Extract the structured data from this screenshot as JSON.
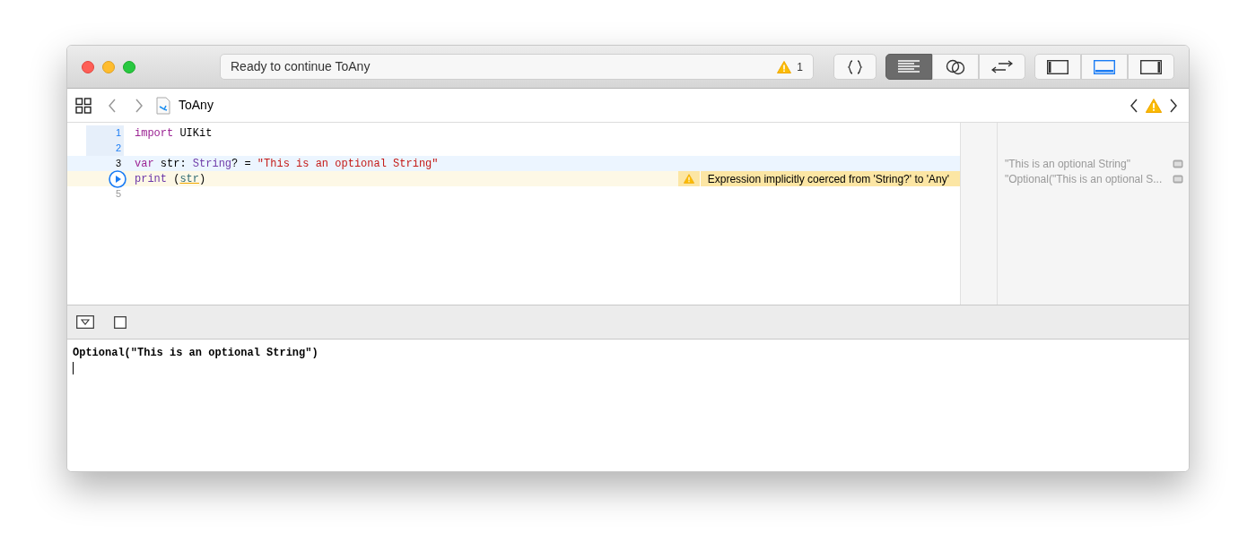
{
  "window": {
    "activity": {
      "status": "Ready to continue ToAny",
      "warning_count": "1"
    }
  },
  "editor_modes": [
    {
      "kind": "code",
      "selected": false
    },
    {
      "kind": "lines",
      "selected": true
    },
    {
      "kind": "rings",
      "selected": false
    },
    {
      "kind": "arrows",
      "selected": false
    }
  ],
  "panel_toggles": [
    {
      "kind": "left",
      "on": false
    },
    {
      "kind": "bottom",
      "on": true
    },
    {
      "kind": "right",
      "on": false
    }
  ],
  "jump_bar": {
    "file": "ToAny"
  },
  "code_lines": [
    {
      "number": "1",
      "executed": true,
      "current": false,
      "tokens": [
        {
          "kind": "keyword",
          "text": "import"
        },
        {
          "kind": "plain",
          "text": " UIKit"
        }
      ]
    },
    {
      "number": "2",
      "executed": true,
      "current": false
    },
    {
      "number": "3",
      "executed": false,
      "current": true,
      "tokens": [
        {
          "kind": "keyword",
          "text": "var"
        },
        {
          "kind": "plain",
          "text": " str: "
        },
        {
          "kind": "type",
          "text": "String"
        },
        {
          "kind": "plain",
          "text": "? = "
        },
        {
          "kind": "string",
          "text": "\"This is an optional String\""
        }
      ],
      "result": "\"This is an optional String\""
    },
    {
      "run_marker": true,
      "executed": false,
      "current": false,
      "tokens": [
        {
          "kind": "function",
          "text": "print"
        },
        {
          "kind": "plain",
          "text": " ("
        },
        {
          "kind": "variable",
          "text": "str"
        },
        {
          "kind": "plain",
          "text": ")"
        }
      ],
      "issue": "Expression implicitly coerced from 'String?' to 'Any'",
      "result": "\"Optional(\"This is an optional S..."
    },
    {
      "number": "5",
      "executed": false,
      "current": false
    }
  ],
  "console": {
    "output": "Optional(\"This is an optional String\")"
  }
}
